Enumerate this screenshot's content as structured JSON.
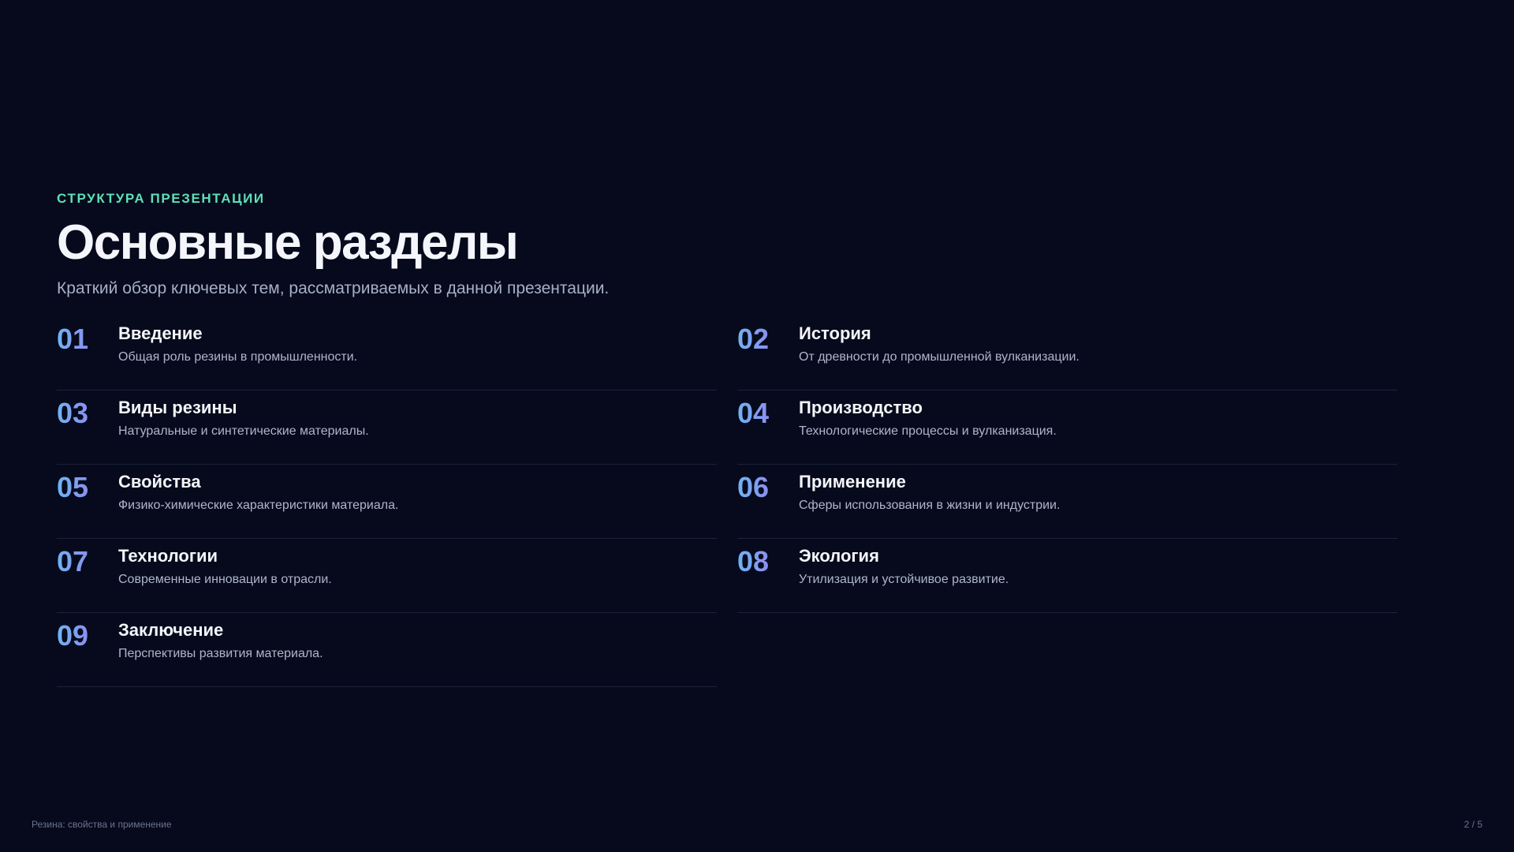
{
  "header": {
    "eyebrow": "СТРУКТУРА ПРЕЗЕНТАЦИИ",
    "title": "Основные разделы",
    "subtitle": "Краткий обзор ключевых тем, рассматриваемых в данной презентации."
  },
  "sections": [
    {
      "number": "01",
      "title": "Введение",
      "description": "Общая роль резины в промышленности."
    },
    {
      "number": "02",
      "title": "История",
      "description": "От древности до промышленной вулканизации."
    },
    {
      "number": "03",
      "title": "Виды резины",
      "description": "Натуральные и синтетические материалы."
    },
    {
      "number": "04",
      "title": "Производство",
      "description": "Технологические процессы и вулканизация."
    },
    {
      "number": "05",
      "title": "Свойства",
      "description": "Физико-химические характеристики материала."
    },
    {
      "number": "06",
      "title": "Применение",
      "description": "Сферы использования в жизни и индустрии."
    },
    {
      "number": "07",
      "title": "Технологии",
      "description": "Современные инновации в отрасли."
    },
    {
      "number": "08",
      "title": "Экология",
      "description": "Утилизация и устойчивое развитие."
    },
    {
      "number": "09",
      "title": "Заключение",
      "description": "Перспективы развития материала."
    }
  ],
  "footer": {
    "left_text": "Резина: свойства и применение",
    "page_indicator": "2 / 5"
  },
  "colors": {
    "background": "#060a1c",
    "accent": "#5fe0b7",
    "number_gradient_start": "#6fb4f2",
    "number_gradient_end": "#8b8ff0"
  }
}
